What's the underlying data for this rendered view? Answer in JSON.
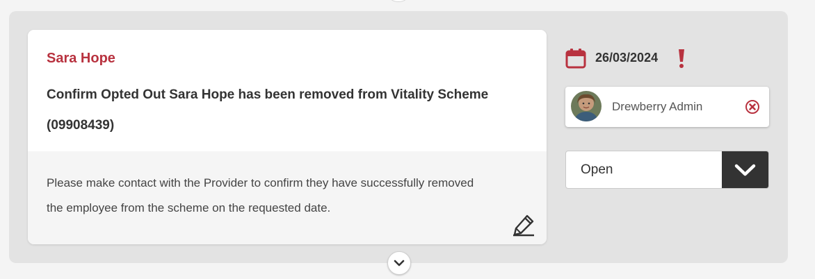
{
  "task": {
    "person_name": "Sara Hope",
    "title": "Confirm Opted Out Sara Hope has been removed from Vitality Scheme (09908439)",
    "description": "Please make contact with the Provider to confirm they have successfully removed the employee from the scheme on the requested date.",
    "edit_icon": "pencil-icon"
  },
  "sidebar": {
    "due_date": "26/03/2024",
    "calendar_icon": "calendar-icon",
    "overdue_icon": "exclamation-icon",
    "assignee": {
      "name": "Drewberry Admin",
      "remove_icon": "remove-circle-icon"
    },
    "status": {
      "value": "Open",
      "dropdown_icon": "chevron-down-icon"
    }
  },
  "expand_icon": "chevron-down-icon",
  "colors": {
    "accent": "#b8323f",
    "panel_bg": "#e3e3e3",
    "card_bg": "#ffffff",
    "card_footer_bg": "#f5f5f5",
    "dark": "#333333"
  }
}
